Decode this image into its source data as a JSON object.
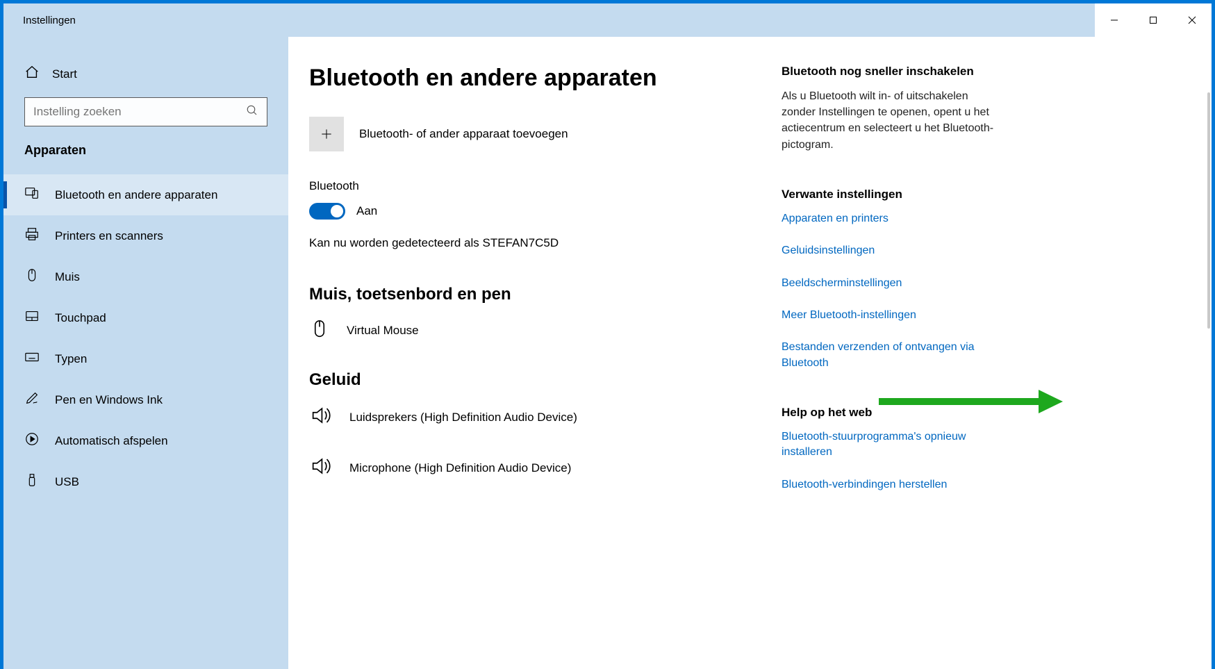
{
  "window": {
    "title": "Instellingen"
  },
  "sidebar": {
    "home": "Start",
    "search_placeholder": "Instelling zoeken",
    "section": "Apparaten",
    "items": [
      {
        "label": "Bluetooth en andere apparaten",
        "icon": "devices",
        "active": true
      },
      {
        "label": "Printers en scanners",
        "icon": "printer"
      },
      {
        "label": "Muis",
        "icon": "mouse"
      },
      {
        "label": "Touchpad",
        "icon": "touchpad"
      },
      {
        "label": "Typen",
        "icon": "keyboard"
      },
      {
        "label": "Pen en Windows Ink",
        "icon": "pen"
      },
      {
        "label": "Automatisch afspelen",
        "icon": "autoplay"
      },
      {
        "label": "USB",
        "icon": "usb"
      }
    ]
  },
  "content": {
    "heading": "Bluetooth en andere apparaten",
    "add_device": "Bluetooth- of ander apparaat toevoegen",
    "bt_label": "Bluetooth",
    "bt_state": "Aan",
    "detect": "Kan nu worden gedetecteerd als STEFAN7C5D",
    "mouse_heading": "Muis, toetsenbord en pen",
    "mouse_device": "Virtual Mouse",
    "sound_heading": "Geluid",
    "sound_devices": [
      "Luidsprekers (High Definition Audio Device)",
      "Microphone (High Definition Audio Device)"
    ]
  },
  "aside": {
    "tip_heading": "Bluetooth nog sneller inschakelen",
    "tip_body": "Als u Bluetooth wilt in- of uitschakelen zonder Instellingen te openen, opent u het actiecentrum en selecteert u het Bluetooth-pictogram.",
    "related_heading": "Verwante instellingen",
    "related_links": [
      "Apparaten en printers",
      "Geluidsinstellingen",
      "Beeldscherminstellingen",
      "Meer Bluetooth-instellingen",
      "Bestanden verzenden of ontvangen via Bluetooth"
    ],
    "help_heading": "Help op het web",
    "help_links": [
      "Bluetooth-stuurprogramma's opnieuw installeren",
      "Bluetooth-verbindingen herstellen"
    ]
  }
}
